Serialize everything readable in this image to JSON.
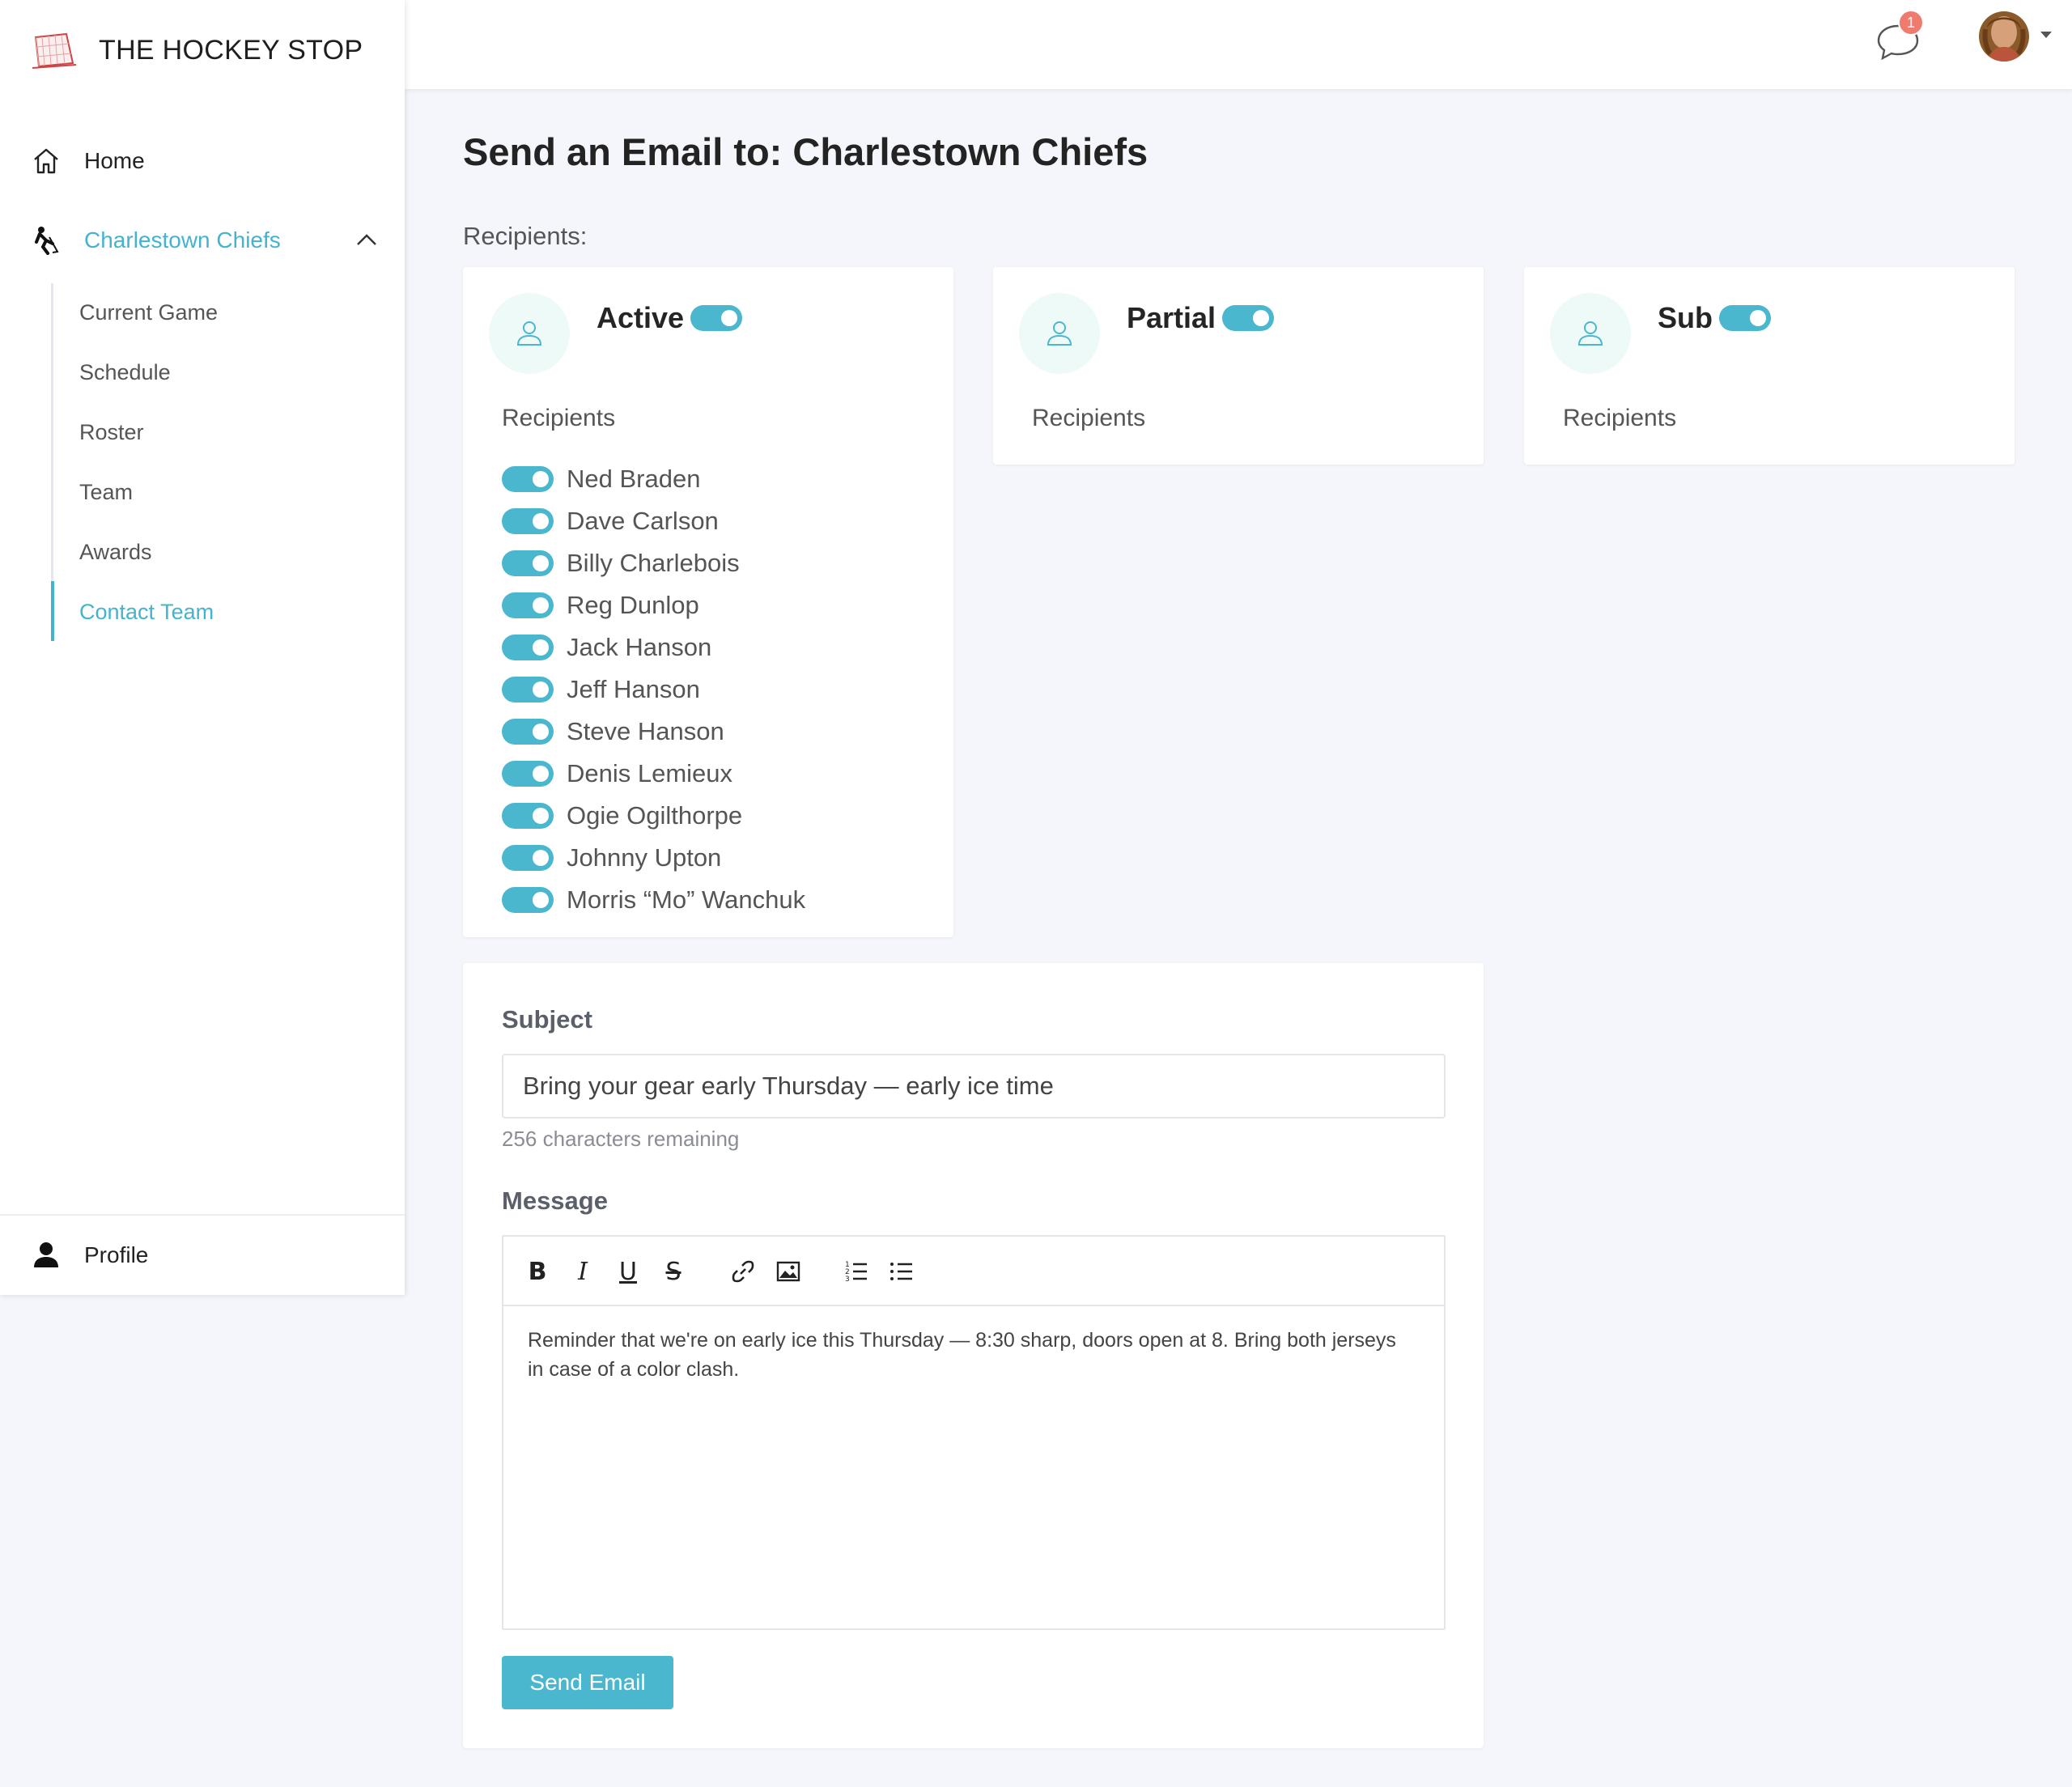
{
  "brand": {
    "name": "THE HOCKEY STOP"
  },
  "nav": {
    "home": "Home",
    "team": "Charlestown Chiefs",
    "sub_items": [
      "Current Game",
      "Schedule",
      "Roster",
      "Team",
      "Awards",
      "Contact Team"
    ],
    "active_sub": "Contact Team",
    "profile": "Profile"
  },
  "topbar": {
    "notification_count": "1"
  },
  "page": {
    "title": "Send an Email to: Charlestown Chiefs",
    "recipients_label": "Recipients:"
  },
  "groups": [
    {
      "title": "Active",
      "enabled": true,
      "list_label": "Recipients",
      "members": [
        "Ned Braden",
        "Dave Carlson",
        "Billy Charlebois",
        "Reg Dunlop",
        "Jack Hanson",
        "Jeff Hanson",
        "Steve Hanson",
        "Denis Lemieux",
        "Ogie Ogilthorpe",
        "Johnny Upton",
        "Morris “Mo” Wanchuk"
      ]
    },
    {
      "title": "Partial",
      "enabled": true,
      "list_label": "Recipients",
      "members": []
    },
    {
      "title": "Sub",
      "enabled": true,
      "list_label": "Recipients",
      "members": []
    }
  ],
  "email": {
    "subject_label": "Subject",
    "subject_value": "Bring your gear early Thursday — early ice time",
    "chars_remaining": "256 characters remaining",
    "message_label": "Message",
    "message_body": "Reminder that we're on early ice this Thursday — 8:30 sharp, doors open at 8. Bring both jerseys in case of a color clash.",
    "send_label": "Send Email"
  },
  "colors": {
    "accent": "#4ab7cf",
    "badge": "#ef7a6e",
    "background": "#f5f6fb"
  }
}
